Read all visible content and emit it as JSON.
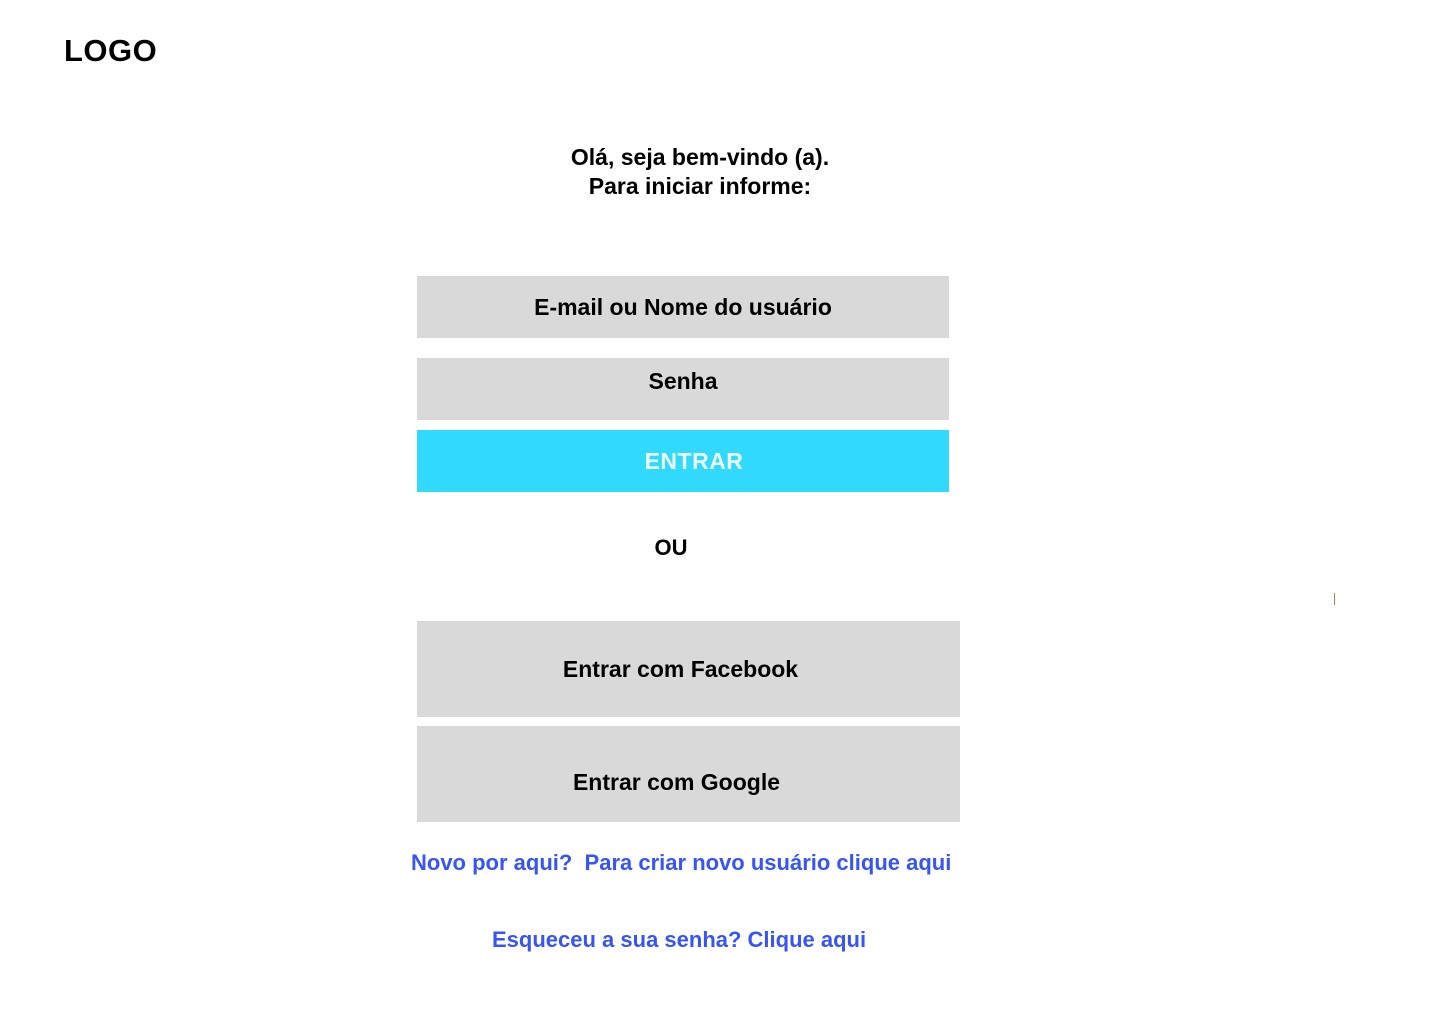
{
  "header": {
    "logo_text": "LOGO"
  },
  "greeting": {
    "line1": "Olá, seja bem-vindo (a).",
    "line2": "Para iniciar informe:"
  },
  "login_form": {
    "username_placeholder": "E-mail ou Nome do usuário",
    "password_placeholder": "Senha",
    "submit_label": "ENTRAR"
  },
  "divider": {
    "label": "OU"
  },
  "social_login": {
    "facebook_label": "Entrar com Facebook",
    "google_label": "Entrar com Google"
  },
  "links": {
    "new_user_prompt": "Novo por aqui?  Para criar novo usuário clique aqui",
    "forgot_password": "Esqueceu a sua senha? Clique aqui"
  },
  "colors": {
    "primary_button": "#31dafd",
    "primary_button_text": "#ebfbff",
    "input_background": "#d9d9d9",
    "link": "#3755f2"
  }
}
